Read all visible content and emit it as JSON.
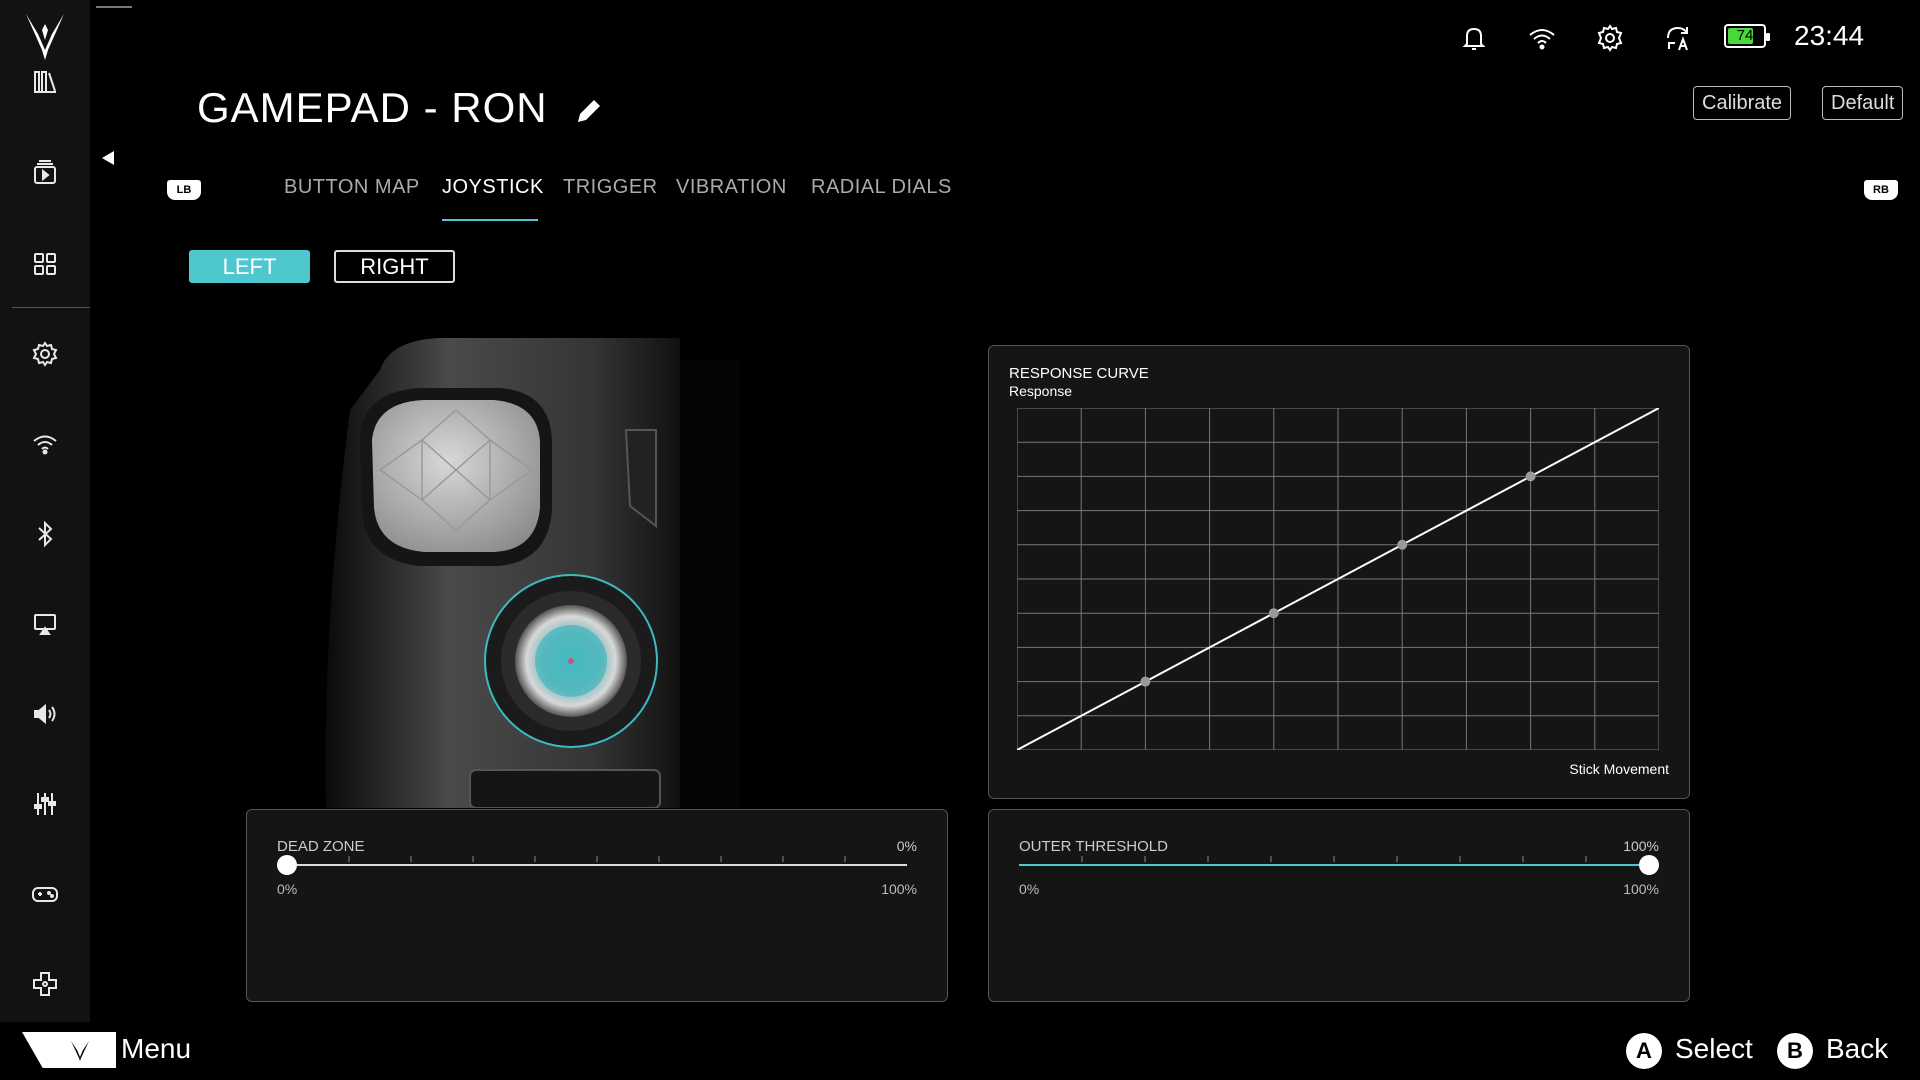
{
  "page": {
    "title": "GAMEPAD - RON",
    "calibrate_label": "Calibrate",
    "default_label": "Default"
  },
  "status": {
    "battery_percent": "74",
    "clock": "23:44",
    "icons": [
      "bell-icon",
      "wifi-icon",
      "gear-icon",
      "sync-a-icon",
      "battery-icon"
    ]
  },
  "sidebar": {
    "items": [
      {
        "icon": "library-icon"
      },
      {
        "icon": "media-icon"
      },
      {
        "icon": "apps-grid-icon"
      },
      {
        "icon": "settings-gear-icon"
      },
      {
        "icon": "wifi-icon"
      },
      {
        "icon": "bluetooth-icon"
      },
      {
        "icon": "display-cast-icon"
      },
      {
        "icon": "volume-icon"
      },
      {
        "icon": "equalizer-icon"
      },
      {
        "icon": "gamepad-icon"
      },
      {
        "icon": "dpad-icon"
      }
    ]
  },
  "tabs": {
    "lb": "LB",
    "rb": "RB",
    "items": [
      {
        "label": "BUTTON MAP"
      },
      {
        "label": "JOYSTICK"
      },
      {
        "label": "TRIGGER"
      },
      {
        "label": "VIBRATION"
      },
      {
        "label": "RADIAL DIALS"
      }
    ],
    "active": "JOYSTICK"
  },
  "stick_select": {
    "left": "LEFT",
    "right": "RIGHT",
    "selected": "LEFT"
  },
  "response_curve": {
    "title": "RESPONSE CURVE",
    "y_label": "Response",
    "x_label": "Stick Movement",
    "points": [
      [
        0,
        0
      ],
      [
        0.2,
        0.2
      ],
      [
        0.4,
        0.4
      ],
      [
        0.6,
        0.6
      ],
      [
        0.8,
        0.8
      ],
      [
        1,
        1
      ]
    ]
  },
  "dead_zone": {
    "label": "DEAD ZONE",
    "value": "0%",
    "min": "0%",
    "max": "100%",
    "level": 0
  },
  "outer_threshold": {
    "label": "OUTER THRESHOLD",
    "value": "100%",
    "min": "0%",
    "max": "100%",
    "level": 1
  },
  "bottom_bar": {
    "menu": "Menu",
    "a_btn": "A",
    "select": "Select",
    "b_btn": "B",
    "back": "Back"
  },
  "colors": {
    "accent": "#4ec7cf",
    "sidebar": "#121212",
    "panel": "#151515"
  }
}
